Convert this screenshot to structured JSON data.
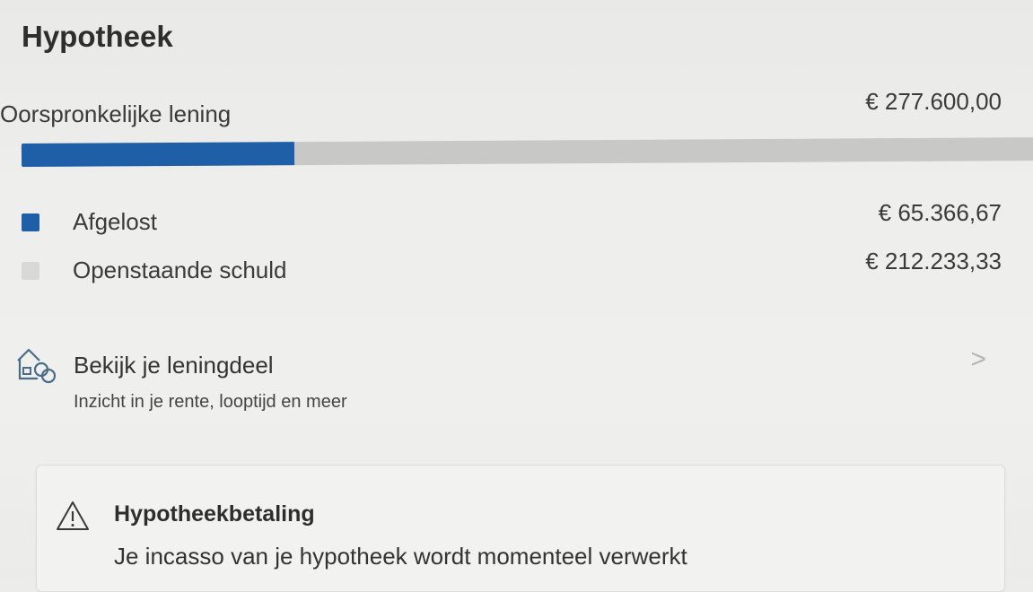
{
  "page": {
    "title": "Hypotheek"
  },
  "loan": {
    "label": "Oorspronkelijke lening",
    "amount": "€ 277.600,00",
    "paid_fraction": 0.27
  },
  "legend": {
    "paid": {
      "label": "Afgelost",
      "value": "€ 65.366,67",
      "color": "#1f5fa8"
    },
    "open": {
      "label": "Openstaande schuld",
      "value": "€ 212.233,33",
      "color": "#d8d8d6"
    }
  },
  "link": {
    "icon": "house-coins-icon",
    "title": "Bekijk je leningdeel",
    "subtitle": "Inzicht in je rente, looptijd en meer",
    "chevron": ">"
  },
  "notice": {
    "icon": "warning-triangle-icon",
    "title": "Hypotheekbetaling",
    "text": "Je incasso van je hypotheek wordt momenteel verwerkt"
  }
}
